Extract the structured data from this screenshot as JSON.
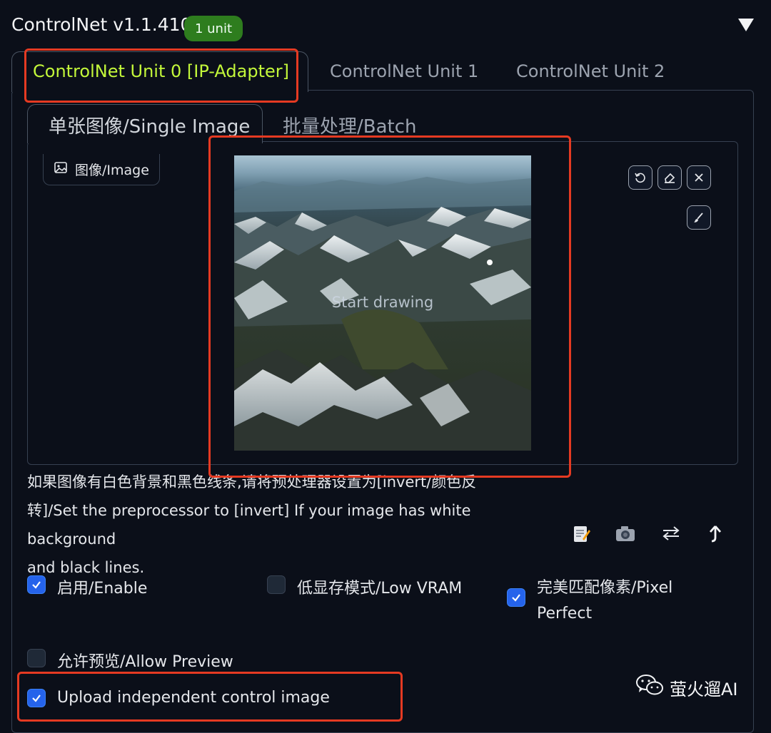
{
  "header": {
    "title": "ControlNet v1.1.410",
    "badge": "1 unit",
    "toggle_icon": "triangle-down-icon"
  },
  "unit_tabs": [
    {
      "label": "ControlNet Unit 0 [IP-Adapter]",
      "active": true
    },
    {
      "label": "ControlNet Unit 1",
      "active": false
    },
    {
      "label": "ControlNet Unit 2",
      "active": false
    }
  ],
  "input_tabs": [
    {
      "label": "单张图像/Single Image",
      "active": true
    },
    {
      "label": "批量处理/Batch",
      "active": false
    }
  ],
  "image_panel": {
    "label": "图像/Image",
    "label_icon": "image-icon",
    "canvas_hint": "Start drawing",
    "toolbar_icons": [
      "undo-icon",
      "eraser-icon",
      "close-icon",
      "brush-icon"
    ]
  },
  "notice": {
    "line1": "如果图像有白色背景和黑色线条,请将预处理器设置为[invert/颜色反",
    "line2": "转]/Set the preprocessor to [invert] If your image has white background",
    "line3": "and black lines."
  },
  "tool_buttons": [
    "edit-notes-icon",
    "camera-icon",
    "swap-icon",
    "send-up-icon"
  ],
  "options": {
    "enable": {
      "label": "启用/Enable",
      "checked": true
    },
    "low_vram": {
      "label": "低显存模式/Low VRAM",
      "checked": false
    },
    "pixel_perfect": {
      "label_line1": "完美匹配像素/Pixel",
      "label_line2": "Perfect",
      "checked": true
    },
    "allow_preview": {
      "label": "允许预览/Allow Preview",
      "checked": false
    },
    "upload_independent": {
      "label": "Upload independent control image",
      "checked": true
    }
  },
  "watermark": {
    "text": "萤火遛AI",
    "icon": "wechat-icon"
  },
  "colors": {
    "background": "#0b0f19",
    "active_tab_text": "#c3f73a",
    "badge_bg": "#2e7d1e",
    "checkbox_checked": "#2563eb",
    "annotation_red": "#e53a22"
  }
}
